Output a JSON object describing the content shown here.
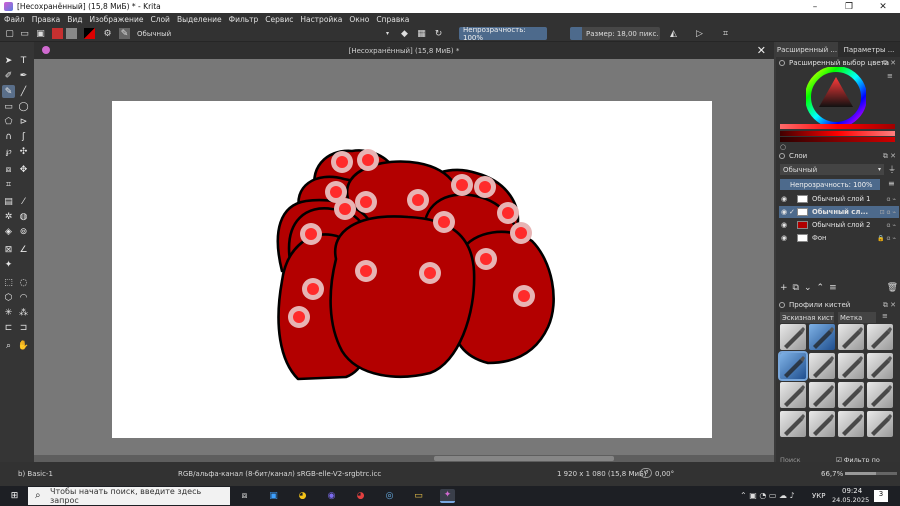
{
  "window": {
    "title": "[Несохранённый]  (15,8 МиБ) * - Krita",
    "controls": [
      "–",
      "❐",
      "✕"
    ]
  },
  "menu": [
    "Файл",
    "Правка",
    "Вид",
    "Изображение",
    "Слой",
    "Выделение",
    "Фильтр",
    "Сервис",
    "Настройка",
    "Окно",
    "Справка"
  ],
  "toolbar": {
    "blend_mode": "Обычный",
    "opacity_label": "Непрозрачность: 100%",
    "size_label": "Размер: 18,00 пикс."
  },
  "canvas": {
    "tab_title": "[Несохранённый]  (15,8 МиБ) *",
    "close": "✕"
  },
  "dock": {
    "tabs": [
      "Расширенный ...",
      "Параметры ..."
    ],
    "color_title": "Расширенный выбор цвета",
    "layers_title": "Слои",
    "layer_blend": "Обычный",
    "layer_opacity": "Непрозрачность:  100%",
    "layers": [
      {
        "name": "Обычный слой 1",
        "selected": false
      },
      {
        "name": "Обычный сл...",
        "selected": true
      },
      {
        "name": "Обычный слой 2",
        "selected": false
      },
      {
        "name": "Фон",
        "selected": false
      }
    ],
    "brushes_title": "Профили кистей",
    "brush_tag": "Эскизная кист",
    "brush_tag_btn": "Метка",
    "search_placeholder": "Поиск",
    "filter_label": "Фильтр по метке"
  },
  "status": {
    "brush": "b) Basic-1",
    "colorspace": "RGB/альфа-канал (8-бит/канал)  sRGB-elle-V2-srgbtrc.icc",
    "dimensions": "1 920 x 1 080 (15,8 МиБ)",
    "rotation": "0,00°",
    "zoom": "66,7%"
  },
  "taskbar": {
    "search_placeholder": "Чтобы начать поиск, введите здесь запрос",
    "lang": "УКР",
    "time": "09:24",
    "date": "24.05.2025",
    "notif_count": "3"
  },
  "colors": {
    "accent": "#4d6a8c",
    "blob_fill": "#b30000",
    "blob_stroke": "#000000",
    "spot_outer": "#e7b4b4",
    "spot_inner": "#ff2b2b"
  }
}
